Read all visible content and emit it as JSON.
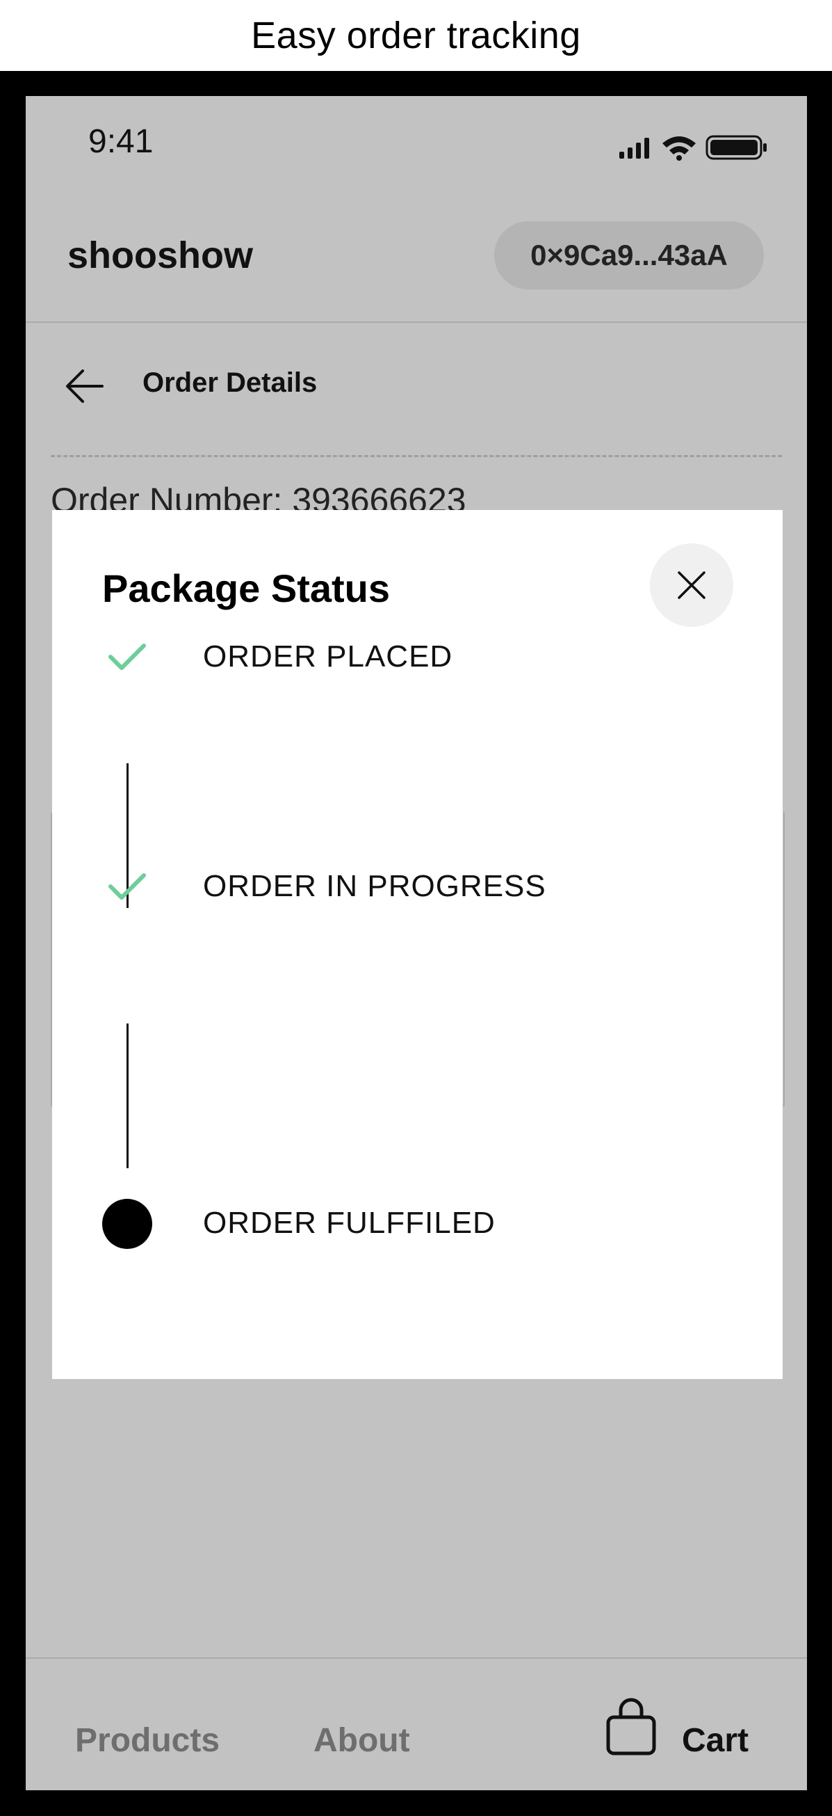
{
  "caption": "Easy order tracking",
  "status_bar": {
    "time": "9:41"
  },
  "header": {
    "brand": "shooshow",
    "wallet_address": "0×9Ca9...43aA"
  },
  "page": {
    "title": "Order Details",
    "order_number": "Order Number: 393666623"
  },
  "modal": {
    "title": "Package Status",
    "steps": [
      {
        "label": "ORDER PLACED",
        "state": "complete",
        "icon": "check-icon"
      },
      {
        "label": "ORDER IN PROGRESS",
        "state": "complete",
        "icon": "check-icon"
      },
      {
        "label": "ORDER FULFFILED",
        "state": "current",
        "icon": "dot-icon"
      }
    ]
  },
  "bottom_nav": {
    "products": "Products",
    "about": "About",
    "cart": "Cart"
  },
  "colors": {
    "overlay_background": "#c2c2c2",
    "check_green": "#6ccf97",
    "modal_background": "#ffffff"
  }
}
